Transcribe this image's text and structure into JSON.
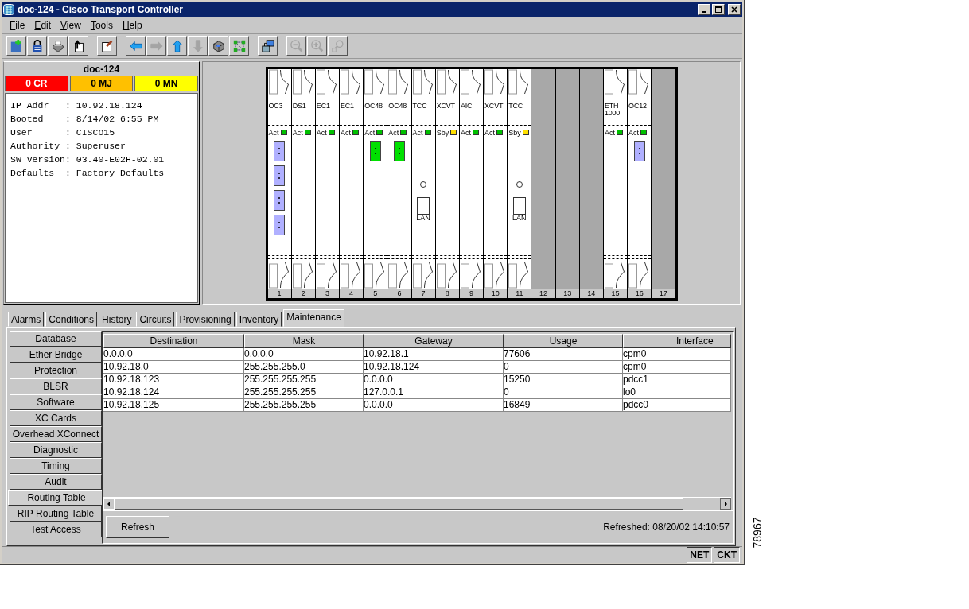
{
  "window": {
    "title": "doc-124 - Cisco Transport Controller"
  },
  "menu": [
    {
      "label": "File"
    },
    {
      "label": "Edit"
    },
    {
      "label": "View"
    },
    {
      "label": "Tools"
    },
    {
      "label": "Help"
    }
  ],
  "toolbar": [
    [
      {
        "kind": "add-node",
        "disabled": false
      },
      {
        "kind": "lock",
        "disabled": false
      },
      {
        "kind": "printer",
        "disabled": false
      },
      {
        "kind": "export",
        "disabled": false
      }
    ],
    [
      {
        "kind": "notes",
        "disabled": false
      }
    ],
    [
      {
        "kind": "back",
        "disabled": false
      },
      {
        "kind": "forward",
        "disabled": true
      },
      {
        "kind": "up",
        "disabled": false
      },
      {
        "kind": "down",
        "disabled": true
      },
      {
        "kind": "shelf",
        "disabled": false
      },
      {
        "kind": "network",
        "disabled": false
      }
    ],
    [
      {
        "kind": "circuits",
        "disabled": false
      }
    ],
    [
      {
        "kind": "zoom-out",
        "disabled": true
      },
      {
        "kind": "zoom-in",
        "disabled": true
      },
      {
        "kind": "zoom-area",
        "disabled": true
      }
    ]
  ],
  "node": {
    "name": "doc-124",
    "alarms": [
      {
        "label": "0 CR",
        "color": "#ff0000"
      },
      {
        "label": "0 MJ",
        "color": "#ffc000"
      },
      {
        "label": "0 MN",
        "color": "#ffff00"
      }
    ],
    "info": [
      "IP Addr   : 10.92.18.124",
      "Booted    : 8/14/02 6:55 PM",
      "User      : CISCO15",
      "Authority : Superuser",
      "SW Version: 03.40-E02H-02.01",
      "Defaults  : Factory Defaults"
    ]
  },
  "shelf": {
    "slots": [
      {
        "number": "1",
        "kind": "card",
        "label": "OC3",
        "status": "Act",
        "color": "#00c000",
        "ports": [
          {
            "color": "#b0b0ff"
          },
          {
            "color": "#b0b0ff"
          },
          {
            "color": "#b0b0ff"
          },
          {
            "color": "#b0b0ff"
          }
        ]
      },
      {
        "number": "2",
        "kind": "card",
        "label": "DS1",
        "status": "Act",
        "color": "#00c000"
      },
      {
        "number": "3",
        "kind": "card",
        "label": "EC1",
        "status": "Act",
        "color": "#00c000"
      },
      {
        "number": "4",
        "kind": "card",
        "label": "EC1",
        "status": "Act",
        "color": "#00c000"
      },
      {
        "number": "5",
        "kind": "card",
        "label": "OC48",
        "status": "Act",
        "color": "#00c000",
        "ports": [
          {
            "color": "#00e000"
          }
        ]
      },
      {
        "number": "6",
        "kind": "card",
        "label": "OC48",
        "status": "Act",
        "color": "#00c000",
        "ports": [
          {
            "color": "#00e000"
          }
        ]
      },
      {
        "number": "7",
        "kind": "tcc",
        "label": "TCC",
        "status": "Act",
        "color": "#00c000",
        "lan_label": "LAN"
      },
      {
        "number": "8",
        "kind": "card",
        "label": "XCVT",
        "status": "Sby",
        "color": "#ffe000"
      },
      {
        "number": "9",
        "kind": "card",
        "label": "AIC",
        "status": "Act",
        "color": "#00c000"
      },
      {
        "number": "10",
        "kind": "card",
        "label": "XCVT",
        "status": "Act",
        "color": "#00c000"
      },
      {
        "number": "11",
        "kind": "tcc",
        "label": "TCC",
        "status": "Sby",
        "color": "#ffe000",
        "lan_label": "LAN"
      },
      {
        "number": "12",
        "kind": "empty"
      },
      {
        "number": "13",
        "kind": "empty"
      },
      {
        "number": "14",
        "kind": "empty"
      },
      {
        "number": "15",
        "kind": "card",
        "label": "ETH 1000",
        "status": "Act",
        "color": "#00c000"
      },
      {
        "number": "16",
        "kind": "card",
        "label": "OC12",
        "status": "Act",
        "color": "#00c000",
        "ports": [
          {
            "color": "#b0b0ff"
          }
        ]
      },
      {
        "number": "17",
        "kind": "empty"
      }
    ]
  },
  "tabs": [
    {
      "label": "Alarms",
      "selected": false
    },
    {
      "label": "Conditions",
      "selected": false
    },
    {
      "label": "History",
      "selected": false
    },
    {
      "label": "Circuits",
      "selected": false
    },
    {
      "label": "Provisioning",
      "selected": false
    },
    {
      "label": "Inventory",
      "selected": false
    },
    {
      "label": "Maintenance",
      "selected": true
    }
  ],
  "subtabs": [
    {
      "label": "Database",
      "selected": false
    },
    {
      "label": "Ether Bridge",
      "selected": false
    },
    {
      "label": "Protection",
      "selected": false
    },
    {
      "label": "BLSR",
      "selected": false
    },
    {
      "label": "Software",
      "selected": false
    },
    {
      "label": "XC Cards",
      "selected": false
    },
    {
      "label": "Overhead XConnect",
      "selected": false
    },
    {
      "label": "Diagnostic",
      "selected": false
    },
    {
      "label": "Timing",
      "selected": false
    },
    {
      "label": "Audit",
      "selected": false
    },
    {
      "label": "Routing Table",
      "selected": true
    },
    {
      "label": "RIP Routing Table",
      "selected": false
    },
    {
      "label": "Test Access",
      "selected": false
    }
  ],
  "table": {
    "columns": [
      "Destination",
      "Mask",
      "Gateway",
      "Usage",
      "Interface"
    ],
    "rows": [
      [
        "0.0.0.0",
        "0.0.0.0",
        "10.92.18.1",
        "77606",
        "cpm0"
      ],
      [
        "10.92.18.0",
        "255.255.255.0",
        "10.92.18.124",
        "0",
        "cpm0"
      ],
      [
        "10.92.18.123",
        "255.255.255.255",
        "0.0.0.0",
        "15250",
        "pdcc1"
      ],
      [
        "10.92.18.124",
        "255.255.255.255",
        "127.0.0.1",
        "0",
        "lo0"
      ],
      [
        "10.92.18.125",
        "255.255.255.255",
        "0.0.0.0",
        "16849",
        "pdcc0"
      ]
    ]
  },
  "refresh_button": "Refresh",
  "refreshed": "Refreshed: 08/20/02 14:10:57",
  "status_bar": [
    "NET",
    "CKT"
  ],
  "figure_number": "78967"
}
